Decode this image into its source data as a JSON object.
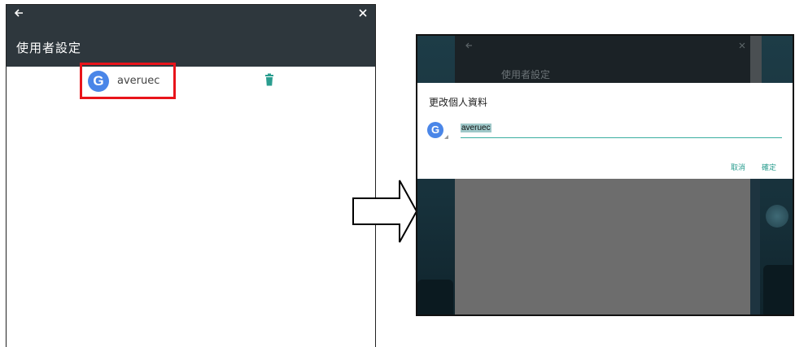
{
  "left_panel": {
    "title": "使用者設定",
    "user": {
      "avatar_letter": "G",
      "name": "averuec"
    },
    "colors": {
      "header": "#2e373d",
      "highlight": "#e8141b",
      "trash": "#2a9d8f"
    }
  },
  "right_panel": {
    "background_title": "使用者設定",
    "dialog": {
      "title": "更改個人資料",
      "avatar_letter": "G",
      "name_value": "averuec",
      "cancel_label": "取消",
      "ok_label": "確定"
    },
    "colors": {
      "accent": "#3aaea0"
    }
  },
  "icons": [
    "back-arrow-icon",
    "close-icon",
    "trash-icon",
    "google-icon",
    "right-arrow-icon"
  ]
}
